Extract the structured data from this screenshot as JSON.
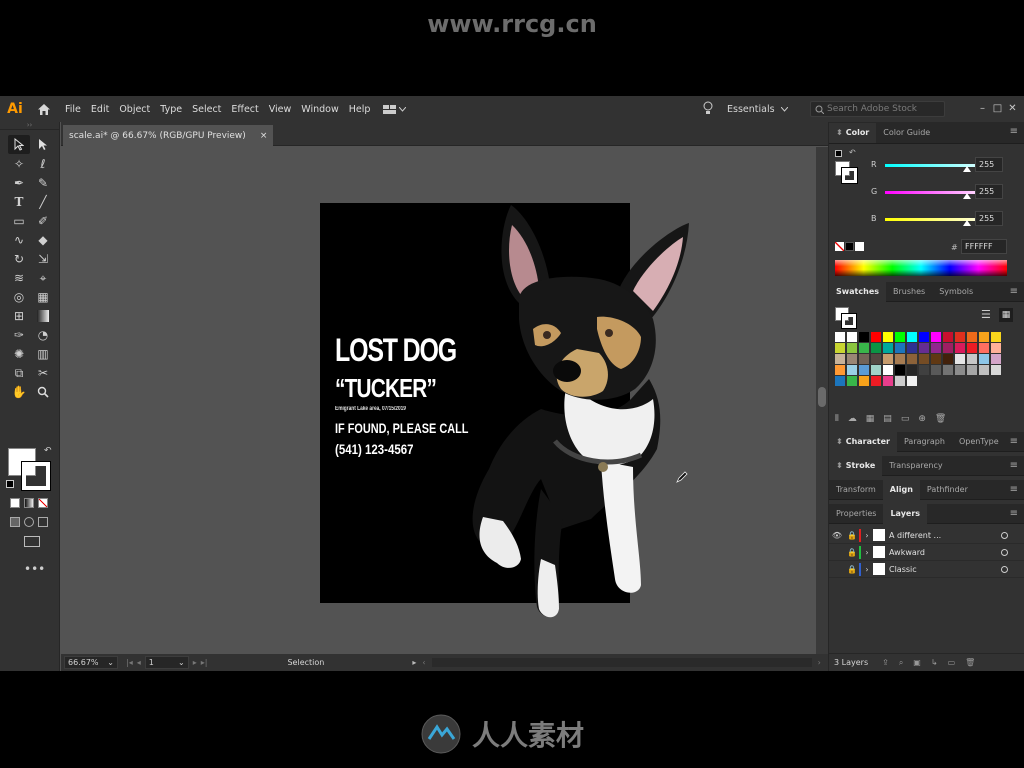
{
  "watermark_top": "www.rrcg.cn",
  "watermark_bottom": "人人素材",
  "app": {
    "logo": "Ai",
    "menu": [
      "File",
      "Edit",
      "Object",
      "Type",
      "Select",
      "Effect",
      "View",
      "Window",
      "Help"
    ],
    "workspace": "Essentials",
    "search_placeholder": "Search Adobe Stock",
    "window_buttons": [
      "–",
      "□",
      "✕"
    ]
  },
  "document": {
    "tab_title": "scale.ai* @ 66.67% (RGB/GPU Preview)",
    "tab_close": "×"
  },
  "poster": {
    "headline": "LOST DOG",
    "name": "“TUCKER”",
    "meta": "Emigrant Lake area, 07/15/2019",
    "call": "IF FOUND, PLEASE CALL",
    "phone": "(541) 123-4567"
  },
  "status": {
    "zoom": "66.67%",
    "artboard": "1",
    "tool": "Selection"
  },
  "color_panel": {
    "tabs": [
      "Color",
      "Color Guide"
    ],
    "channels": [
      {
        "label": "R",
        "value": "255",
        "color": "#26d6d6"
      },
      {
        "label": "G",
        "value": "255",
        "color": "#d020d0"
      },
      {
        "label": "B",
        "value": "255",
        "color": "#e8e820"
      }
    ],
    "hex_label": "#",
    "hex": "FFFFFF"
  },
  "swatches_panel": {
    "tabs": [
      "Swatches",
      "Brushes",
      "Symbols"
    ],
    "rows": [
      [
        "#ffffff",
        "#ffffff",
        "#000000",
        "#ff0000",
        "#ffff00",
        "#00ff00",
        "#00ffff",
        "#0000ff",
        "#ff00ff",
        "#c8102e",
        "#e0301e",
        "#ee6a1a",
        "#f7a21b",
        "#f9d71c"
      ],
      [
        "#c9d531",
        "#8bc53f",
        "#39b54a",
        "#0b9444",
        "#00a99d",
        "#1c75bc",
        "#2e3192",
        "#662d91",
        "#92278f",
        "#9e1f63",
        "#d91b5c",
        "#ed1c24",
        "#ff6f61",
        "#ffb199"
      ],
      [
        "#c7b299",
        "#998675",
        "#736357",
        "#534741",
        "#c69c6d",
        "#a67c52",
        "#8c6239",
        "#754c24",
        "#603813",
        "#42210b",
        "#e6e6e6",
        "#c7c7c7",
        "#8dc6e8",
        "#d4a5c9"
      ],
      [
        "#ff9933",
        "#9ad0e6",
        "#5b9bd5",
        "#a1d3c8",
        "#ffffff",
        "#000000",
        "#262626",
        "#404040",
        "#595959",
        "#737373",
        "#8c8c8c",
        "#a6a6a6",
        "#bfbfbf",
        "#d9d9d9"
      ],
      [
        "#1c75bc",
        "#39b54a",
        "#f7a21b",
        "#ed1c24",
        "#e83e8c",
        "#cccccc",
        "#f2f2f2"
      ]
    ]
  },
  "panel_tabs": {
    "character": [
      "Character",
      "Paragraph",
      "OpenType"
    ],
    "stroke": [
      "Stroke",
      "Transparency"
    ],
    "transform": [
      "Transform",
      "Align",
      "Pathfinder"
    ],
    "layers": [
      "Properties",
      "Layers"
    ]
  },
  "layers": {
    "items": [
      {
        "name": "A different ...",
        "color": "#e02020",
        "visible": true
      },
      {
        "name": "Awkward",
        "color": "#20c040",
        "visible": false
      },
      {
        "name": "Classic",
        "color": "#3060d0",
        "visible": false
      }
    ],
    "count": "3 Layers"
  },
  "colors": {
    "app_bg": "#535353",
    "panel_bg": "#323232",
    "accent_ai": "#ff9a00"
  }
}
